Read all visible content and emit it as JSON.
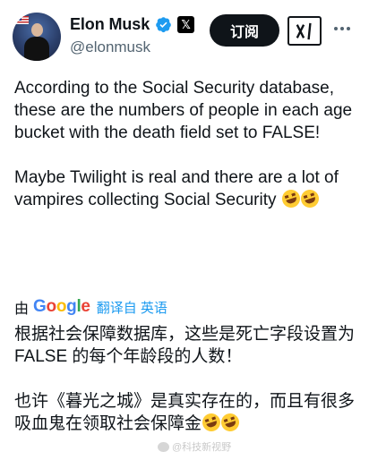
{
  "author": {
    "display_name": "Elon Musk",
    "handle": "@elonmusk",
    "avatar_icon": "avatar-photo-icon",
    "verified_icon": "verified-badge-icon",
    "affiliation_icon": "x-logo-icon",
    "accent_color": "#1d9bf0"
  },
  "actions": {
    "subscribe_label": "订阅",
    "grok_icon": "grok-icon",
    "more_icon": "more-horizontal-icon"
  },
  "post": {
    "paragraph1": "According to the Social Security database, these are the numbers of people in each age bucket with the death field set to FALSE!",
    "paragraph2": "Maybe Twilight is real and there are a lot of vampires collecting Social Security"
  },
  "translation": {
    "by_label": "由",
    "provider": "Google",
    "link_label": "翻译自 英语",
    "paragraph1": "根据社会保障数据库，这些是死亡字段设置为 FALSE 的每个年龄段的人数！",
    "paragraph2": "也许《暮光之城》是真实存在的，而且有很多吸血鬼在领取社会保障金"
  },
  "emoji_icon": "rolling-on-floor-laughing-icon",
  "watermark": {
    "text": "@科技新视野"
  }
}
